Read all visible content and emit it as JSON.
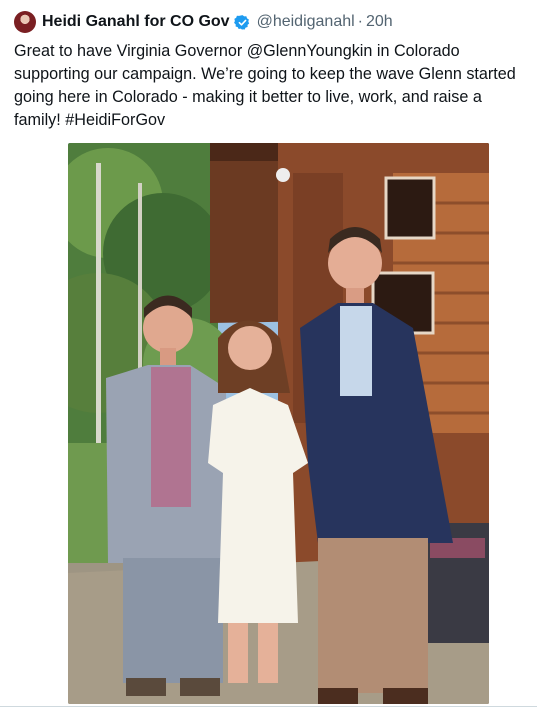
{
  "tweet": {
    "author_name": "Heidi Ganahl for CO Gov",
    "handle": "@heidiganahl",
    "separator": "·",
    "time": "20h",
    "text_lines": [
      "Great to have Virginia Governor @GlennYoungkin in Colorado",
      "supporting our campaign. We’re going to keep the wave Glenn started",
      "going here in Colorado - making it better to live, work, and raise a",
      "family! #HeidiForGov"
    ]
  },
  "colors": {
    "accent": "#1d9bf0",
    "text": "#0f1419",
    "muted": "#536471"
  },
  "icons": {
    "verified": "verified-badge-icon"
  }
}
